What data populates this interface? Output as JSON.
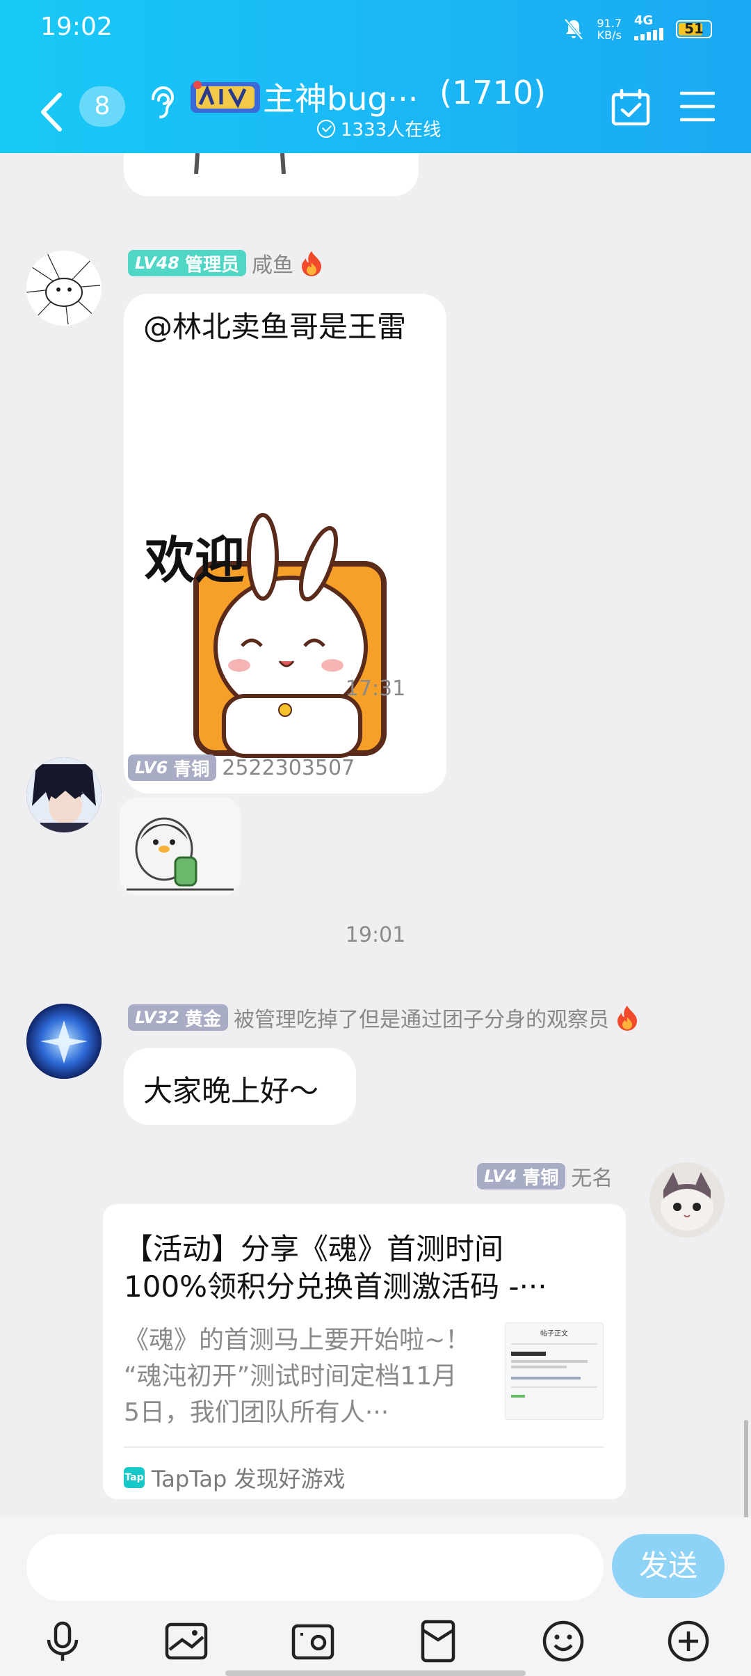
{
  "status_bar": {
    "time": "19:02",
    "net_speed_value": "91.7",
    "net_speed_unit": "KB/s",
    "signal": "4G",
    "battery": "51"
  },
  "header": {
    "unread_count": "8",
    "group_name": "主神bug···",
    "member_count": "(1710)",
    "online": "1333人在线"
  },
  "chat": {
    "messages": [
      {
        "level": "LV48",
        "title": "管理员",
        "name": "咸鱼",
        "text": "@林北卖鱼哥是王雷",
        "sticker_text": "欢迎"
      },
      {
        "time": "17:31"
      },
      {
        "level": "LV6",
        "title": "青铜",
        "name": "2522303507"
      },
      {
        "time": "19:01"
      },
      {
        "level": "LV32",
        "title": "黄金",
        "name": "被管理吃掉了但是通过团子分身的观察员",
        "text": "大家晚上好～"
      },
      {
        "level": "LV4",
        "title": "青铜",
        "name": "无名",
        "share": {
          "title_line1": "【活动】分享《魂》首测时间",
          "title_line2": "100%领积分兑换首测激活码 -···",
          "desc_line1": "《魂》的首测马上要开始啦~！",
          "desc_line2": "“魂沌初开”测试时间定档11月",
          "desc_line3": "5日，我们团队所有人···",
          "thumb_title": "帖子正文",
          "source": "TapTap 发现好游戏",
          "source_icon": "Tap"
        }
      }
    ]
  },
  "input": {
    "placeholder": "",
    "send_label": "发送"
  },
  "colors": {
    "header": "#1bb7f5",
    "send": "#8ed2f6",
    "admin_badge": "#4fd6c4",
    "rank_badge": "#a8acc4"
  }
}
